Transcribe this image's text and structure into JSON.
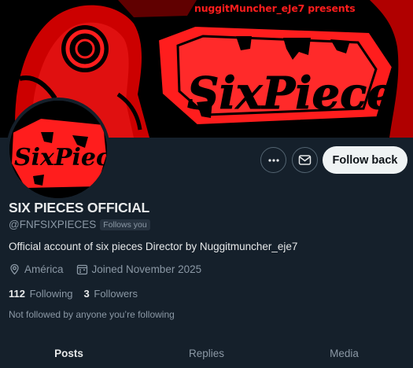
{
  "banner": {
    "credit": "nuggitMuncher_eJe7 presents",
    "logo_text": "SixPiece"
  },
  "avatar": {
    "logo_text": "SixPiece"
  },
  "actions": {
    "more_icon": "more-horizontal-icon",
    "message_icon": "envelope-icon",
    "follow_label": "Follow back"
  },
  "profile": {
    "display_name": "SIX PIECES OFFICIAL",
    "handle": "@FNFSIXPIECES",
    "follows_you": "Follows you",
    "bio": "Official account of six pieces Director by Nuggitmuncher_eje7",
    "location": "América",
    "joined": "Joined November 2025",
    "following_count": "112",
    "following_label": "Following",
    "followers_count": "3",
    "followers_label": "Followers",
    "not_followed_text": "Not followed by anyone you’re following"
  },
  "tabs": [
    {
      "label": "Posts",
      "active": true
    },
    {
      "label": "Replies",
      "active": false
    },
    {
      "label": "Media",
      "active": false
    }
  ],
  "colors": {
    "background": "#15202b",
    "banner_red": "#ff1d1d",
    "follow_button": "#eff3f4",
    "muted_text": "#8b98a5"
  }
}
